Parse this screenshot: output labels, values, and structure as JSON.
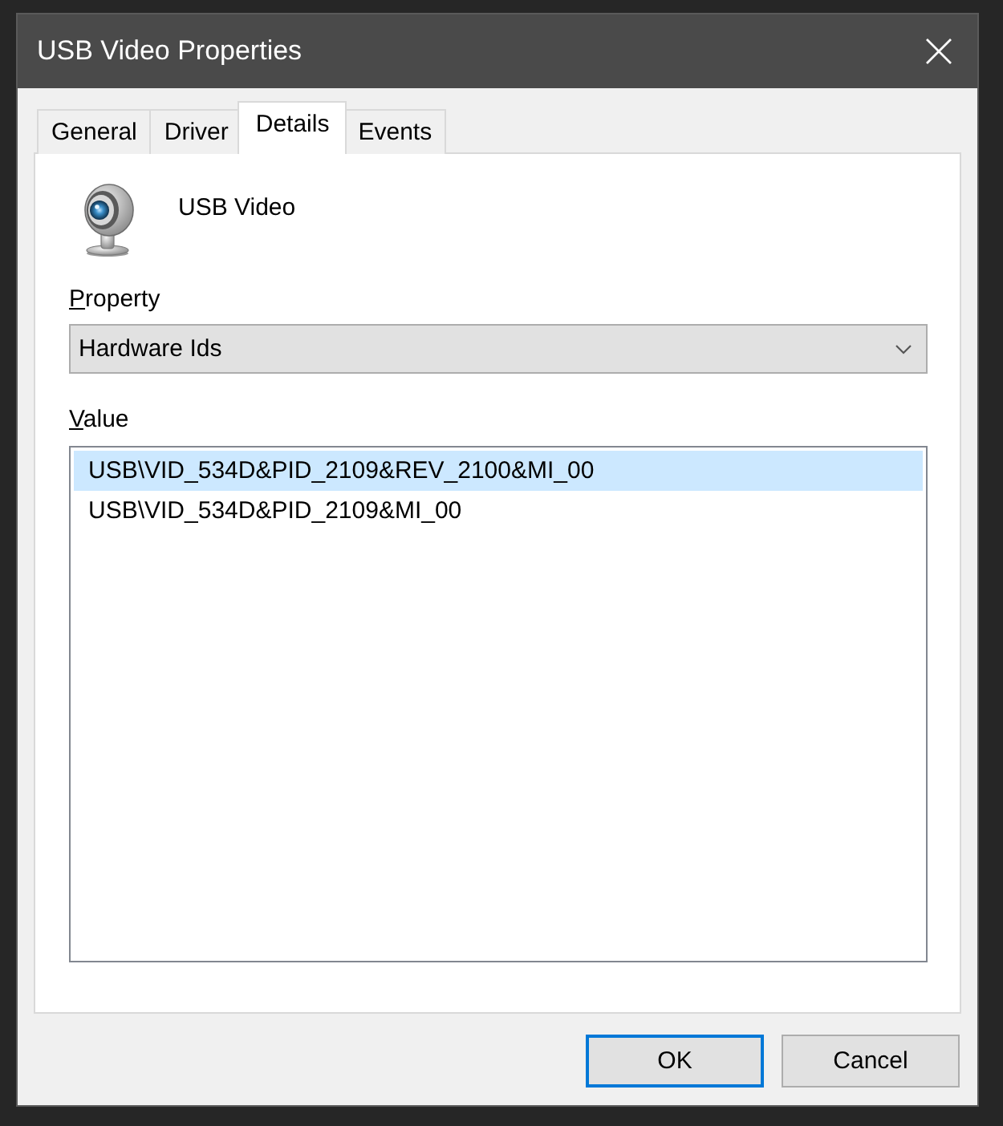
{
  "window": {
    "title": "USB Video Properties"
  },
  "tabs": [
    {
      "label": "General",
      "selected": false
    },
    {
      "label": "Driver",
      "selected": false
    },
    {
      "label": "Details",
      "selected": true
    },
    {
      "label": "Events",
      "selected": false
    }
  ],
  "device": {
    "name": "USB Video"
  },
  "property": {
    "label": "Property",
    "value": "Hardware Ids"
  },
  "value": {
    "label": "Value",
    "items": [
      {
        "text": "USB\\VID_534D&PID_2109&REV_2100&MI_00",
        "selected": true
      },
      {
        "text": "USB\\VID_534D&PID_2109&MI_00",
        "selected": false
      }
    ]
  },
  "buttons": [
    {
      "label": "OK",
      "default": true
    },
    {
      "label": "Cancel",
      "default": false
    }
  ]
}
